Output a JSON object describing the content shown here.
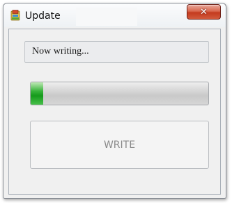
{
  "window": {
    "title": "Update",
    "app_icon": "installer-icon",
    "close_icon": "close-icon",
    "close_glyph": "✕"
  },
  "status": {
    "text": "Now writing..."
  },
  "progress": {
    "fraction": 0.07,
    "fill_color": "#2fae33"
  },
  "actions": {
    "write_label": "WRITE",
    "write_enabled": false
  }
}
